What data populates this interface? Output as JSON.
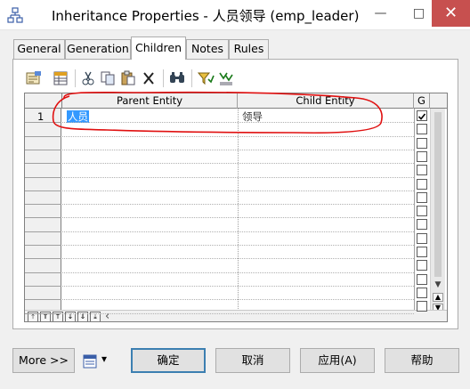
{
  "window": {
    "title": "Inheritance Properties - 人员领导 (emp_leader)",
    "minimize_symbol": "—",
    "maximize_symbol": "□",
    "close_symbol": "✕"
  },
  "tabs": [
    {
      "label": "General",
      "active": false
    },
    {
      "label": "Generation",
      "active": false
    },
    {
      "label": "Children",
      "active": true
    },
    {
      "label": "Notes",
      "active": false
    },
    {
      "label": "Rules",
      "active": false
    }
  ],
  "toolbar": {
    "icons": [
      "properties-icon",
      "add-rows-icon",
      "cut-icon",
      "copy-icon",
      "paste-icon",
      "delete-icon",
      "find-icon",
      "filter-icon",
      "customize-columns-icon"
    ]
  },
  "grid": {
    "columns": {
      "parent": "Parent Entity",
      "child": "Child Entity",
      "generate": "G"
    },
    "rows": [
      {
        "num": "1",
        "parent": "人员",
        "child": "领导",
        "generate": true
      }
    ],
    "nav_buttons": [
      "⤒",
      "⇑",
      "↑",
      "↓",
      "⇓",
      "⤓"
    ],
    "hscroll_left_arrow": "‹"
  },
  "buttons": {
    "more": "More >>",
    "menu_arrow": "▾",
    "ok": "确定",
    "cancel": "取消",
    "apply": "应用(A)",
    "help": "帮助"
  },
  "colors": {
    "accent": "#3c7fb1",
    "close": "#c7504f",
    "annotation": "#e01010",
    "selection": "#3399ff"
  }
}
